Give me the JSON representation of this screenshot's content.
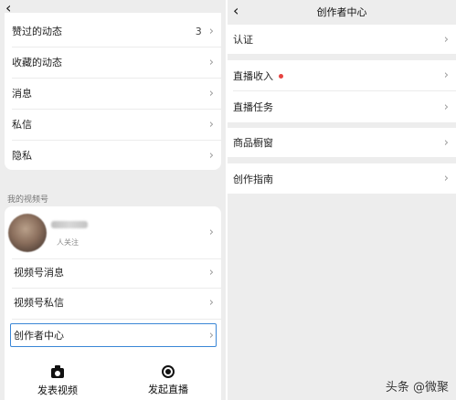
{
  "left": {
    "menu": [
      {
        "label": "赞过的动态",
        "count": "3"
      },
      {
        "label": "收藏的动态"
      },
      {
        "label": "消息"
      },
      {
        "label": "私信"
      },
      {
        "label": "隐私"
      }
    ],
    "section_label": "我的视频号",
    "profile": {
      "followers_label": "人关注"
    },
    "channel_items": [
      {
        "label": "视频号消息"
      },
      {
        "label": "视频号私信"
      },
      {
        "label": "创作者中心"
      }
    ],
    "actions": {
      "post_video": "发表视频",
      "go_live": "发起直播"
    }
  },
  "right": {
    "title": "创作者中心",
    "items": {
      "verify": "认证",
      "live_income": "直播收入",
      "live_tasks": "直播任务",
      "shop_window": "商品橱窗",
      "guide": "创作指南"
    }
  },
  "watermark": "头条 @微聚",
  "colors": {
    "accent_blue": "#3a86d6",
    "red_dot": "#e64340"
  }
}
